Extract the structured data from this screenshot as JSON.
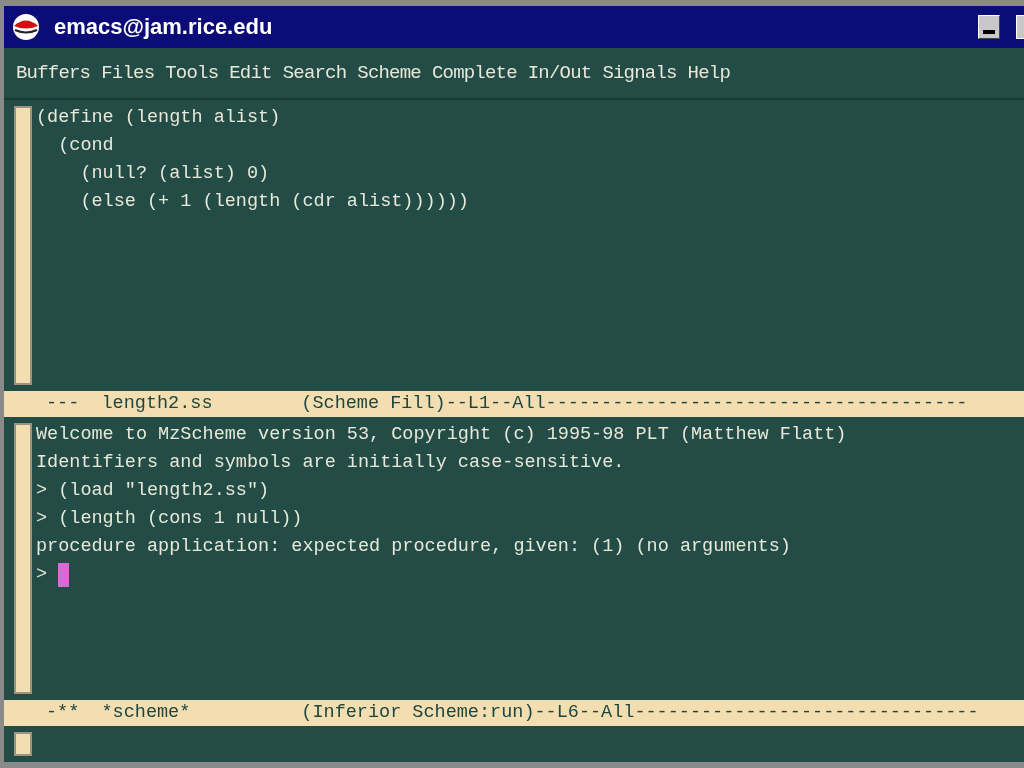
{
  "window": {
    "title": "emacs@jam.rice.edu"
  },
  "menu": [
    "Buffers",
    "Files",
    "Tools",
    "Edit",
    "Search",
    "Scheme",
    "Complete",
    "In/Out",
    "Signals",
    "Help"
  ],
  "panes": [
    {
      "lines": [
        {
          "text": "(define (length alist)"
        },
        {
          "text": "  (cond"
        },
        {
          "text": "    (null? (alist) 0)"
        },
        {
          "text": "    (else (+ 1 (length (cdr alist))))))"
        }
      ],
      "mode_line": "---  length2.ss        (Scheme Fill)--L1--All--------------------------------------"
    },
    {
      "lines": [
        {
          "text": "Welcome to MzScheme version 53, Copyright (c) 1995-98 PLT (Matthew Flatt)"
        },
        {
          "text": "Identifiers and symbols are initially case-sensitive."
        },
        {
          "text": "> (load \"length2.ss\")"
        },
        {
          "text": "> (length (cons 1 null))"
        },
        {
          "text": "procedure application: expected procedure, given: (1) (no arguments)"
        },
        {
          "text": "> ",
          "cursor": true
        }
      ],
      "mode_line": "-**  *scheme*          (Inferior Scheme:run)--L6--All-------------------------------"
    }
  ]
}
